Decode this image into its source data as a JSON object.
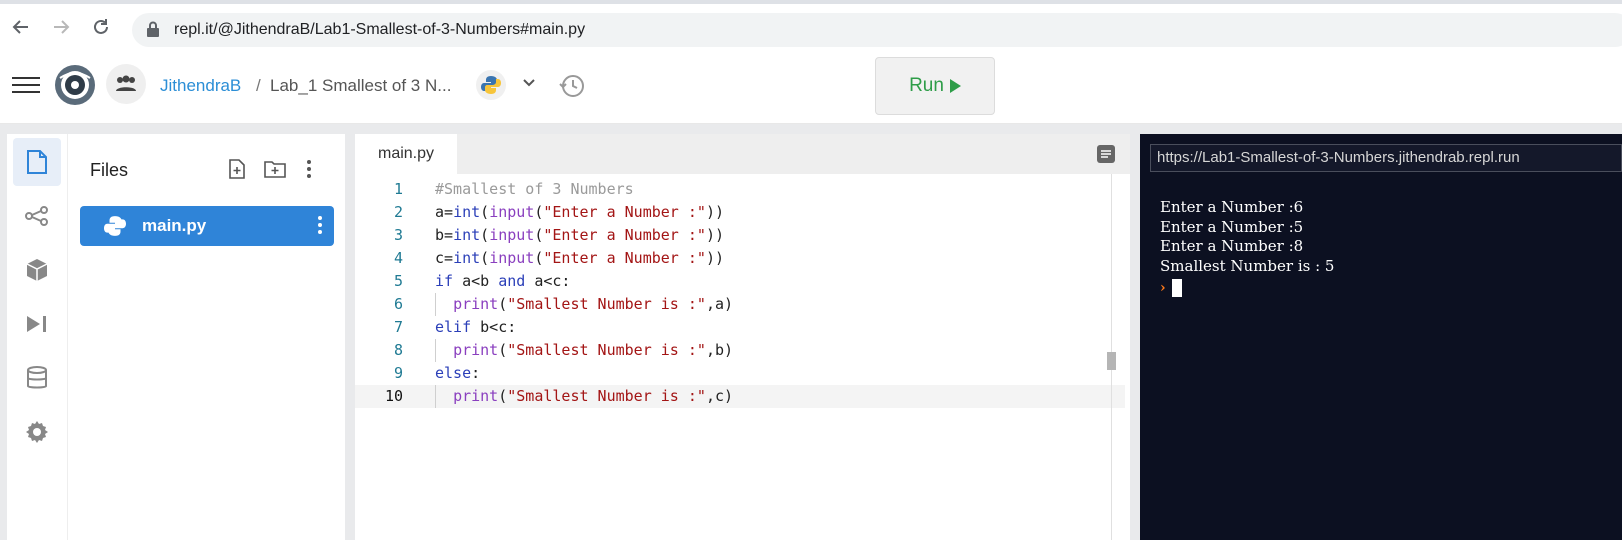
{
  "browser": {
    "url": "repl.it/@JithendraB/Lab1-Smallest-of-3-Numbers#main.py"
  },
  "header": {
    "username": "JithendraB",
    "separator": "/",
    "repl_name": "Lab_1 Smallest of 3 N...",
    "run_label": "Run",
    "language_icon": "python-icon"
  },
  "sidebar": {
    "items": [
      {
        "icon": "file-icon",
        "active": true
      },
      {
        "icon": "share-icon"
      },
      {
        "icon": "package-icon"
      },
      {
        "icon": "debugger-icon"
      },
      {
        "icon": "database-icon"
      },
      {
        "icon": "gear-icon"
      }
    ]
  },
  "files": {
    "title": "Files",
    "items": [
      {
        "name": "main.py",
        "selected": true
      }
    ]
  },
  "editor": {
    "tab": "main.py",
    "current_line": 10,
    "lines": [
      {
        "n": "1",
        "tokens": [
          [
            "c",
            "#Smallest of 3 Numbers"
          ]
        ]
      },
      {
        "n": "2",
        "tokens": [
          [
            "p",
            "a="
          ],
          [
            "k",
            "int"
          ],
          [
            "p",
            "("
          ],
          [
            "b",
            "input"
          ],
          [
            "p",
            "("
          ],
          [
            "s",
            "\"Enter a Number :\""
          ],
          [
            "p",
            "))"
          ]
        ]
      },
      {
        "n": "3",
        "tokens": [
          [
            "p",
            "b="
          ],
          [
            "k",
            "int"
          ],
          [
            "p",
            "("
          ],
          [
            "b",
            "input"
          ],
          [
            "p",
            "("
          ],
          [
            "s",
            "\"Enter a Number :\""
          ],
          [
            "p",
            "))"
          ]
        ]
      },
      {
        "n": "4",
        "tokens": [
          [
            "p",
            "c="
          ],
          [
            "k",
            "int"
          ],
          [
            "p",
            "("
          ],
          [
            "b",
            "input"
          ],
          [
            "p",
            "("
          ],
          [
            "s",
            "\"Enter a Number :\""
          ],
          [
            "p",
            "))"
          ]
        ]
      },
      {
        "n": "5",
        "tokens": [
          [
            "k",
            "if"
          ],
          [
            "p",
            " a<b "
          ],
          [
            "k",
            "and"
          ],
          [
            "p",
            " a<c:"
          ]
        ]
      },
      {
        "n": "6",
        "indent": true,
        "tokens": [
          [
            "p",
            "  "
          ],
          [
            "b",
            "print"
          ],
          [
            "p",
            "("
          ],
          [
            "s",
            "\"Smallest Number is :\""
          ],
          [
            "p",
            ",a)"
          ]
        ]
      },
      {
        "n": "7",
        "tokens": [
          [
            "k",
            "elif"
          ],
          [
            "p",
            " b<c:"
          ]
        ]
      },
      {
        "n": "8",
        "indent": true,
        "tokens": [
          [
            "p",
            "  "
          ],
          [
            "b",
            "print"
          ],
          [
            "p",
            "("
          ],
          [
            "s",
            "\"Smallest Number is :\""
          ],
          [
            "p",
            ",b)"
          ]
        ]
      },
      {
        "n": "9",
        "tokens": [
          [
            "k",
            "else"
          ],
          [
            "p",
            ":"
          ]
        ]
      },
      {
        "n": "10",
        "indent": true,
        "tokens": [
          [
            "p",
            "  "
          ],
          [
            "b",
            "print"
          ],
          [
            "p",
            "("
          ],
          [
            "s",
            "\"Smallest Number is :\""
          ],
          [
            "p",
            ",c)"
          ]
        ]
      }
    ]
  },
  "console": {
    "url": "https://Lab1-Smallest-of-3-Numbers.jithendrab.repl.run",
    "output": [
      "Enter a Number :6",
      "Enter a Number :5",
      "Enter a Number :8",
      "Smallest Number is : 5"
    ],
    "prompt": "›"
  },
  "colors": {
    "accent": "#2f84d8",
    "run_green": "#2e9d48",
    "console_bg": "#0c1021"
  }
}
